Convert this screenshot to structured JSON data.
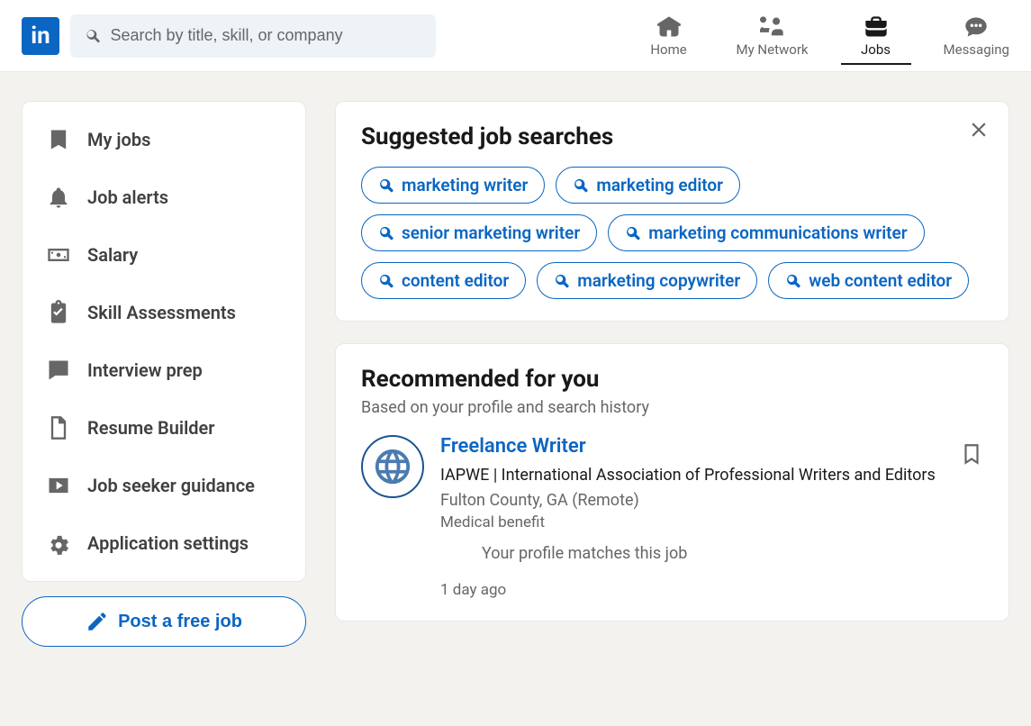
{
  "header": {
    "search_placeholder": "Search by title, skill, or company",
    "nav": [
      {
        "label": "Home"
      },
      {
        "label": "My Network"
      },
      {
        "label": "Jobs",
        "active": true
      },
      {
        "label": "Messaging"
      }
    ]
  },
  "sidebar": {
    "items": [
      {
        "label": "My jobs"
      },
      {
        "label": "Job alerts"
      },
      {
        "label": "Salary"
      },
      {
        "label": "Skill Assessments"
      },
      {
        "label": "Interview prep"
      },
      {
        "label": "Resume Builder"
      },
      {
        "label": "Job seeker guidance"
      },
      {
        "label": "Application settings"
      }
    ],
    "post_job_label": "Post a free job"
  },
  "suggested": {
    "title": "Suggested job searches",
    "pills": [
      "marketing writer",
      "marketing editor",
      "senior marketing writer",
      "marketing communications writer",
      "content editor",
      "marketing copywriter",
      "web content editor"
    ]
  },
  "recommended": {
    "title": "Recommended for you",
    "subtitle": "Based on your profile and search history",
    "job": {
      "title": "Freelance Writer",
      "company": "IAPWE | International Association of Professional Writers and Editors",
      "location": "Fulton County, GA (Remote)",
      "benefit": "Medical benefit",
      "match": "Your profile matches this job",
      "age": "1 day ago"
    }
  }
}
